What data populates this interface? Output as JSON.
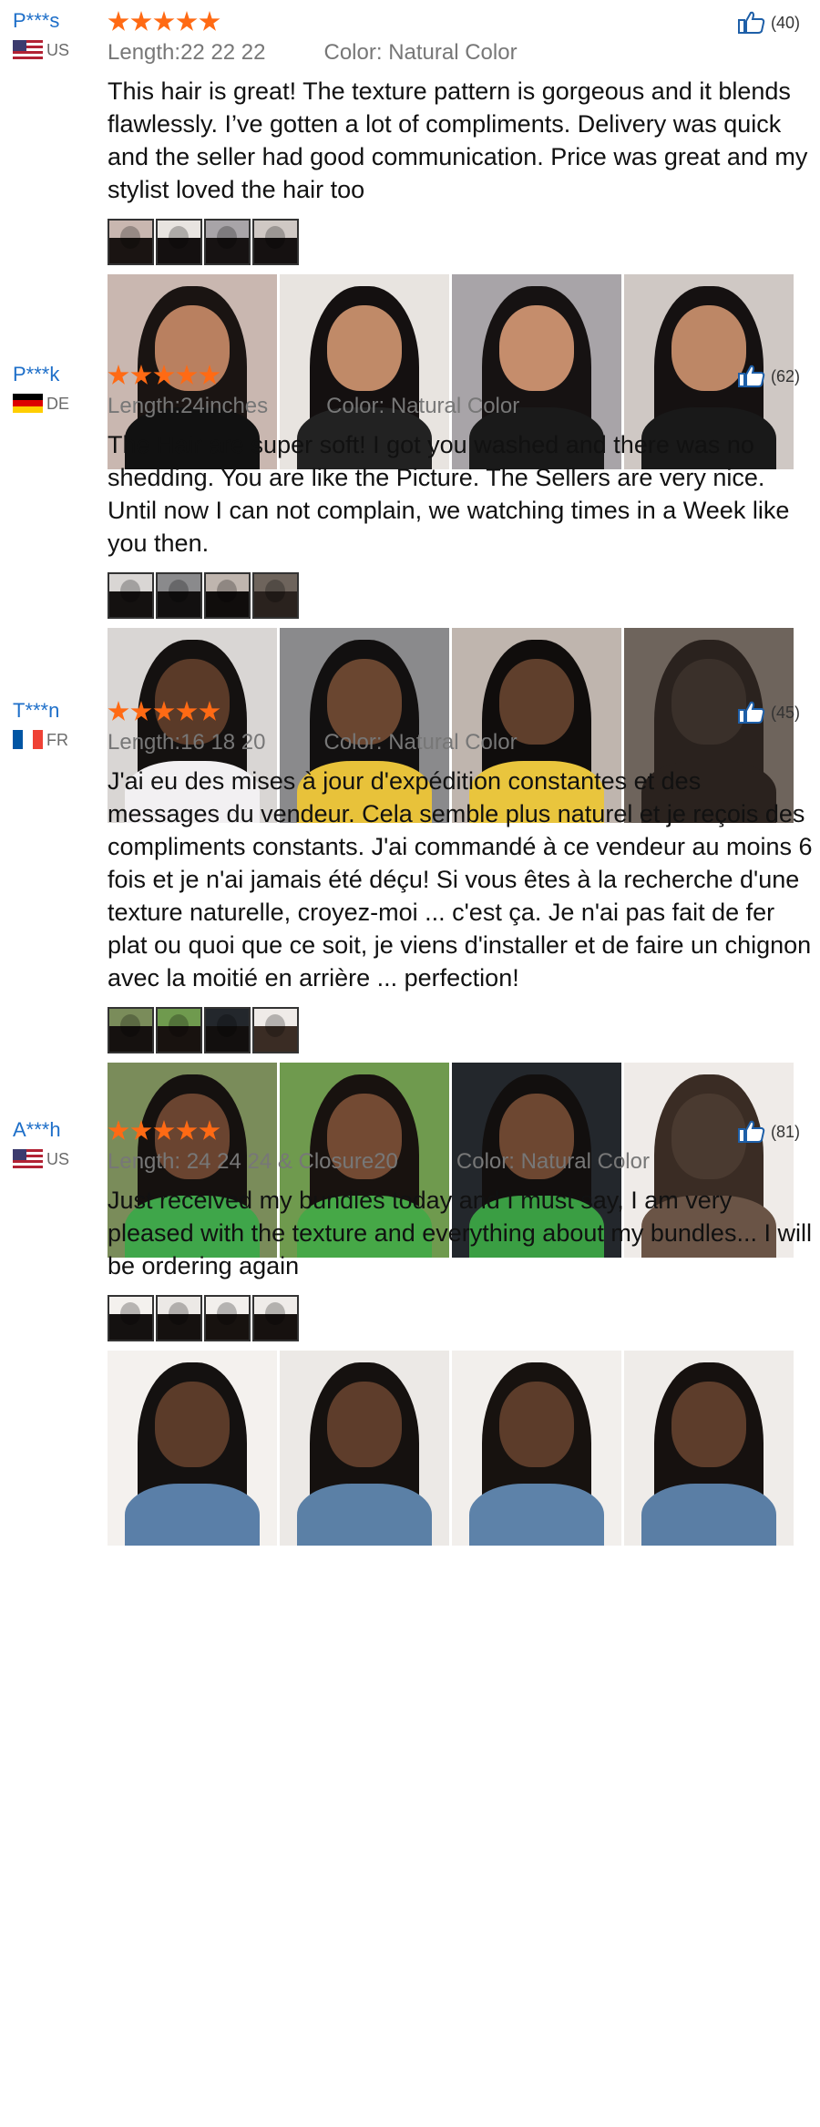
{
  "reviews": [
    {
      "reviewer": "P***s",
      "country": "US",
      "flag": "flag-us",
      "rating": 5,
      "likes": "(40)",
      "length": "Length:22 22 22",
      "color": "Color: Natural Color",
      "text": "This hair is great! The texture pattern is gorgeous and it blends flawlessly. I’ve gotten a lot of compliments. Delivery was quick and the seller had good communication. Price was great and my stylist loved the hair too",
      "photo_palette": [
        {
          "bg": "#c9b7b0",
          "hair": "#1a1412",
          "skin": "#b98060",
          "body": "#111"
        },
        {
          "bg": "#e8e4e0",
          "hair": "#141010",
          "skin": "#c08a68",
          "body": "#222"
        },
        {
          "bg": "#a8a4a8",
          "hair": "#161212",
          "skin": "#c58d6c",
          "body": "#1a1a1a"
        },
        {
          "bg": "#cfc8c4",
          "hair": "#151111",
          "skin": "#bd8766",
          "body": "#191919"
        }
      ]
    },
    {
      "reviewer": "P***k",
      "country": "DE",
      "flag": "flag-de",
      "rating": 5,
      "likes": "(62)",
      "length": "Length:24inches",
      "color": "Color: Natural Color",
      "text": "The Hair are super soft! I got you washed and there was no shedding. You are like the Picture. The Sellers are very nice. Until now I can not complain, we watching times in a Week like you then.",
      "photo_palette": [
        {
          "bg": "#d9d6d4",
          "hair": "#141110",
          "skin": "#5a3a28",
          "body": "#f2f0f2"
        },
        {
          "bg": "#8a8a8c",
          "hair": "#121010",
          "skin": "#6a4630",
          "body": "#e8c23a"
        },
        {
          "bg": "#bfb5ae",
          "hair": "#100d0c",
          "skin": "#5f3f2c",
          "body": "#e9c53d"
        },
        {
          "bg": "#6e645c",
          "hair": "#2a221e",
          "skin": "#3a302a",
          "body": "#2a221e"
        }
      ]
    },
    {
      "reviewer": "T***n",
      "country": "FR",
      "flag": "flag-fr",
      "rating": 5,
      "likes": "(45)",
      "length": "Length:16 18 20",
      "color": "Color: Natural Color",
      "text": "J'ai eu des mises à jour d'expédition constantes et des messages du vendeur. Cela semble plus naturel et je reçois des compliments constants. J'ai commandé à ce vendeur au moins 6 fois et je n'ai jamais été déçu! Si vous êtes à la recherche d'une texture naturelle, croyez-moi ... c'est ça. Je n'ai pas fait de fer plat ou quoi que ce soit, je viens d'installer et de faire un chignon avec la moitié en arrière ... perfection!",
      "photo_palette": [
        {
          "bg": "#7a8c5a",
          "hair": "#15110f",
          "skin": "#6a4430",
          "body": "#3fa64a"
        },
        {
          "bg": "#6f9a4e",
          "hair": "#18120f",
          "skin": "#734a33",
          "body": "#46a847"
        },
        {
          "bg": "#23272c",
          "hair": "#120f0e",
          "skin": "#6d4731",
          "body": "#3a9e43"
        },
        {
          "bg": "#efebe8",
          "hair": "#3a2c24",
          "skin": "#4a3a30",
          "body": "#6a5446"
        }
      ]
    },
    {
      "reviewer": "A***h",
      "country": "US",
      "flag": "flag-us",
      "rating": 5,
      "likes": "(81)",
      "length": "Length: 24 24 24 & Closure20",
      "color": "Color: Natural Color",
      "text": "Just received my bundles today and I must say, I am very pleased with the texture and everything about my bundles... I will be ordering again",
      "photo_palette": [
        {
          "bg": "#f4f1ee",
          "hair": "#141110",
          "skin": "#5b3b29",
          "body": "#5a7fa8"
        },
        {
          "bg": "#ece9e6",
          "hair": "#15110f",
          "skin": "#5e3d2b",
          "body": "#5b80a6"
        },
        {
          "bg": "#f2efec",
          "hair": "#17120f",
          "skin": "#5c3c2a",
          "body": "#5d82a9"
        },
        {
          "bg": "#efece9",
          "hair": "#16110f",
          "skin": "#5d3d2b",
          "body": "#5a7ea5"
        }
      ]
    }
  ]
}
